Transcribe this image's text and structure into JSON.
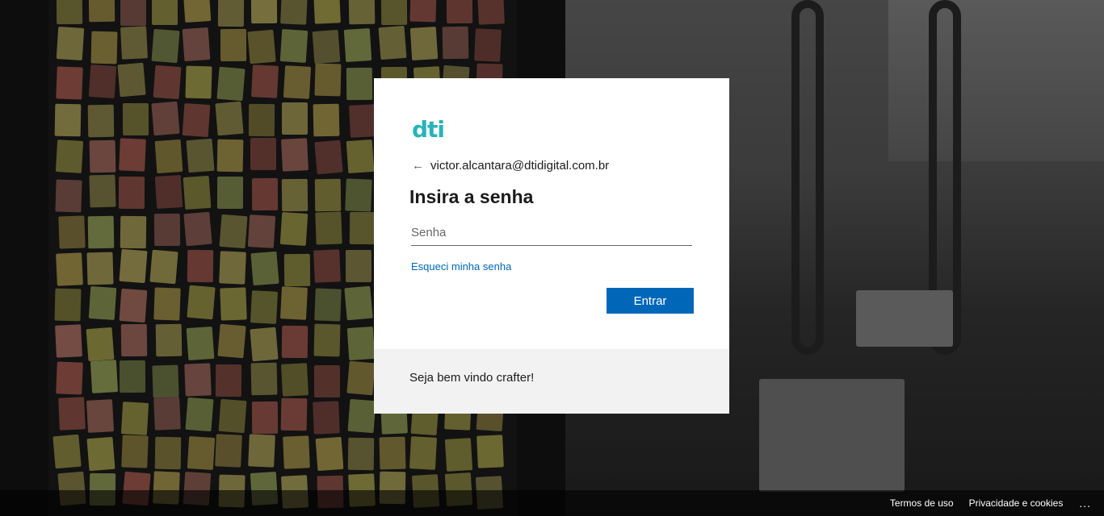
{
  "logo": {
    "text": "dti",
    "color": "#27b3b8"
  },
  "identity": {
    "back_icon": "arrow-left-icon",
    "email": "victor.alcantara@dtidigital.com.br"
  },
  "form": {
    "title": "Insira a senha",
    "password_placeholder": "Senha",
    "password_value": "",
    "forgot_label": "Esqueci minha senha",
    "submit_label": "Entrar"
  },
  "banner": {
    "text": "Seja bem vindo crafter!"
  },
  "footer": {
    "links": [
      "Termos de uso",
      "Privacidade e cookies"
    ],
    "more_label": "..."
  },
  "colors": {
    "accent": "#0067b8",
    "link": "#0067b8",
    "banner_bg": "#f2f2f2"
  }
}
